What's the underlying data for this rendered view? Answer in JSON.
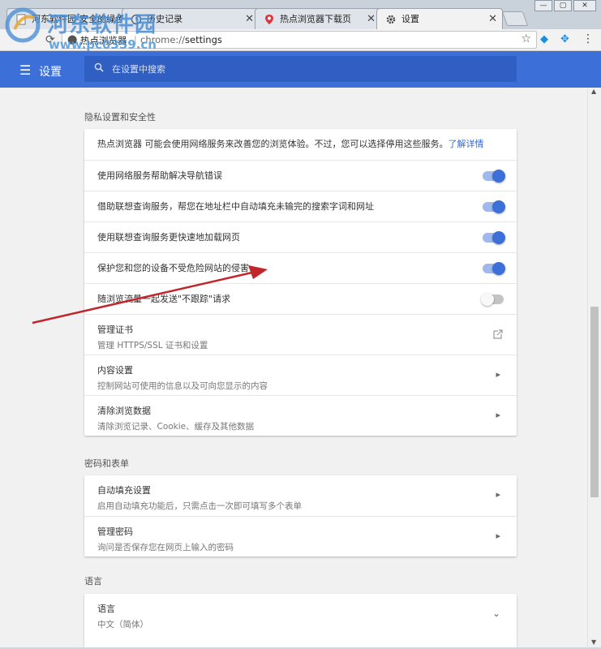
{
  "tabs": [
    {
      "title": "河东软件园-安全的绿色…",
      "icon": "page-icon"
    },
    {
      "title": "历史记录",
      "icon": "history-icon"
    },
    {
      "title": "热点浏览器下载页",
      "icon": "map-pin-icon"
    },
    {
      "title": "设置",
      "icon": "gear-icon"
    }
  ],
  "window": {
    "minimize": "—",
    "maximize": "▢",
    "close": "✕"
  },
  "omnibox": {
    "site": "热点浏览器",
    "scheme": "chrome://",
    "path": "settings"
  },
  "watermark": {
    "name": "河东软件园",
    "url": "www.pc0359.cn"
  },
  "header": {
    "title": "设置",
    "search_placeholder": "在设置中搜索"
  },
  "privacy": {
    "title": "隐私设置和安全性",
    "intro": "热点浏览器 可能会使用网络服务来改善您的浏览体验。不过，您可以选择停用这些服务。",
    "learn_more": "了解详情",
    "toggles": [
      {
        "label": "使用网络服务帮助解决导航错误",
        "on": true
      },
      {
        "label": "借助联想查询服务，帮您在地址栏中自动填充未输完的搜索字词和网址",
        "on": true
      },
      {
        "label": "使用联想查询服务更快速地加载网页",
        "on": true
      },
      {
        "label": "保护您和您的设备不受危险网站的侵害",
        "on": true
      },
      {
        "label": "随浏览流量一起发送\"不跟踪\"请求",
        "on": false
      }
    ],
    "certificates": {
      "title": "管理证书",
      "subtitle": "管理 HTTPS/SSL 证书和设置"
    },
    "content_settings": {
      "title": "内容设置",
      "subtitle": "控制网站可使用的信息以及可向您显示的内容"
    },
    "clear_data": {
      "title": "清除浏览数据",
      "subtitle": "清除浏览记录、Cookie、缓存及其他数据"
    }
  },
  "passwords": {
    "title": "密码和表单",
    "autofill": {
      "title": "自动填充设置",
      "subtitle": "启用自动填充功能后，只需点击一次即可填写多个表单"
    },
    "manage": {
      "title": "管理密码",
      "subtitle": "询问是否保存您在网页上输入的密码"
    }
  },
  "languages": {
    "title": "语言",
    "language": {
      "title": "语言",
      "subtitle": "中文（简体）"
    }
  },
  "colors": {
    "accent": "#3d6fd8",
    "arrow": "#c0272d"
  }
}
